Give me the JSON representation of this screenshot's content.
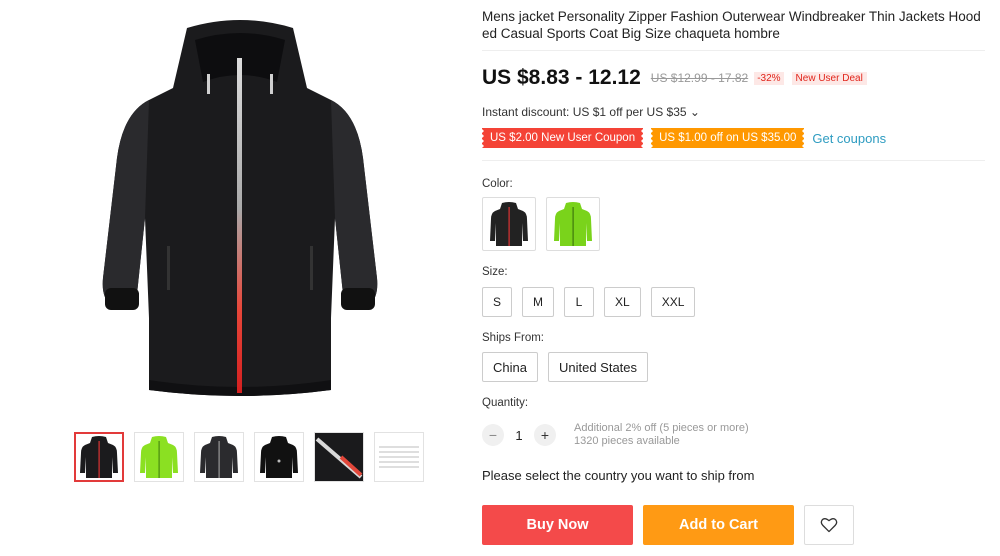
{
  "product": {
    "title": "Mens jacket Personality Zipper Fashion Outerwear Windbreaker Thin Jackets Hooded Casual Sports Coat Big Size chaqueta hombre",
    "price": "US $8.83 - 12.12",
    "original_price": "US $12.99 - 17.82",
    "discount": "-32%",
    "deal_tag": "New User Deal",
    "instant_discount": "Instant discount: US $1 off per US $35",
    "instant_chevron": "⌄"
  },
  "coupons": [
    {
      "label": "US $2.00 New User Coupon",
      "color": "#f44336"
    },
    {
      "label": "US $1.00 off on US $35.00",
      "color": "#ff9800"
    }
  ],
  "get_coupons": "Get coupons",
  "color": {
    "label": "Color:",
    "options": [
      {
        "name": "black-jacket",
        "swatch": "#222222"
      },
      {
        "name": "green-jacket",
        "swatch": "#7ad31b"
      }
    ]
  },
  "size": {
    "label": "Size:",
    "options": [
      "S",
      "M",
      "L",
      "XL",
      "XXL"
    ]
  },
  "ships_from": {
    "label": "Ships From:",
    "options": [
      "China",
      "United States"
    ]
  },
  "quantity": {
    "label": "Quantity:",
    "minus": "−",
    "value": "1",
    "plus": "+",
    "bulk_note": "Additional 2% off (5 pieces or more)",
    "available": "1320 pieces available"
  },
  "ship_message": "Please select the country you want to ship from",
  "actions": {
    "buy_now": "Buy Now",
    "add_to_cart": "Add to Cart",
    "wishlist_icon": "heart-icon"
  },
  "colors": {
    "accent_red": "#f44a4a",
    "accent_orange": "#ff9a14",
    "link_blue": "#2e9cc1"
  }
}
